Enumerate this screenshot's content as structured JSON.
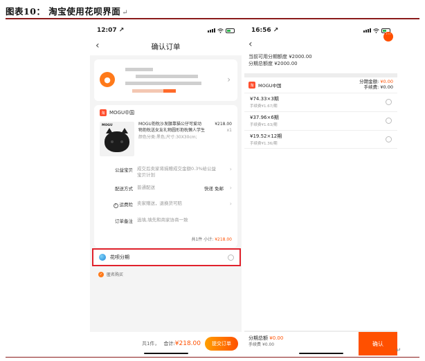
{
  "caption": {
    "title": "图表10：  淘宝使用花呗界面",
    "mark": "↵"
  },
  "footmark": "↵",
  "left": {
    "status": {
      "time": "12:07 ↗"
    },
    "nav": {
      "title": "确认订单",
      "back": "‹"
    },
    "shop": {
      "name": "MOGU中国",
      "logo": "淘",
      "product": {
        "brand": "MOGU",
        "title": "MOGU抱枕沙发腰靠猫公仔可爱动物抱枕送女友礼物圆形抱枕懒人学生",
        "spec": "颜色分类:黑色;尺寸:30X30cm;",
        "price": "¥218.00",
        "qty": "x1"
      },
      "rows": [
        {
          "label": "公益宝贝",
          "value": "成交后卖家将捐赠成交金额0.3%给公益宝贝计划",
          "right": ""
        },
        {
          "label": "配送方式",
          "value": "普通配送",
          "right": "快递 免邮"
        },
        {
          "label": "运费险",
          "value": "卖家赠送，退换货可赔",
          "right": ""
        },
        {
          "label": "订单备注",
          "value": "选填,填先和商家协商一致",
          "right": ""
        }
      ],
      "subtotal": {
        "count": "共1件",
        "label": "小计:",
        "amount": "¥218.00"
      }
    },
    "huabei": {
      "label": "花呗分期"
    },
    "anon": {
      "label": "匿名购买"
    },
    "footer": {
      "count": "共1件，",
      "total_label": "合计:",
      "total": "¥218.00",
      "submit": "提交订单"
    }
  },
  "right": {
    "status": {
      "time": "16:56 ↗"
    },
    "limits": [
      "当前可用分期额度 ¥2000.00",
      "分期总额度 ¥2000.00"
    ],
    "panel": {
      "shop": "MOGU中国",
      "amount_label": "分期金额:",
      "amount": "¥0.00",
      "fee_label": "手续费:",
      "fee": "¥0.00",
      "plans": [
        {
          "term": "¥74.33×3期",
          "fee": "手续费¥1.67/期"
        },
        {
          "term": "¥37.96×6期",
          "fee": "手续费¥1.63/期"
        },
        {
          "term": "¥19.52×12期",
          "fee": "手续费¥1.36/期"
        }
      ]
    },
    "footer": {
      "total_label": "分期总额",
      "total": "¥0.00",
      "fee_label": "手续费",
      "fee": "¥0.00",
      "confirm": "确认"
    }
  }
}
